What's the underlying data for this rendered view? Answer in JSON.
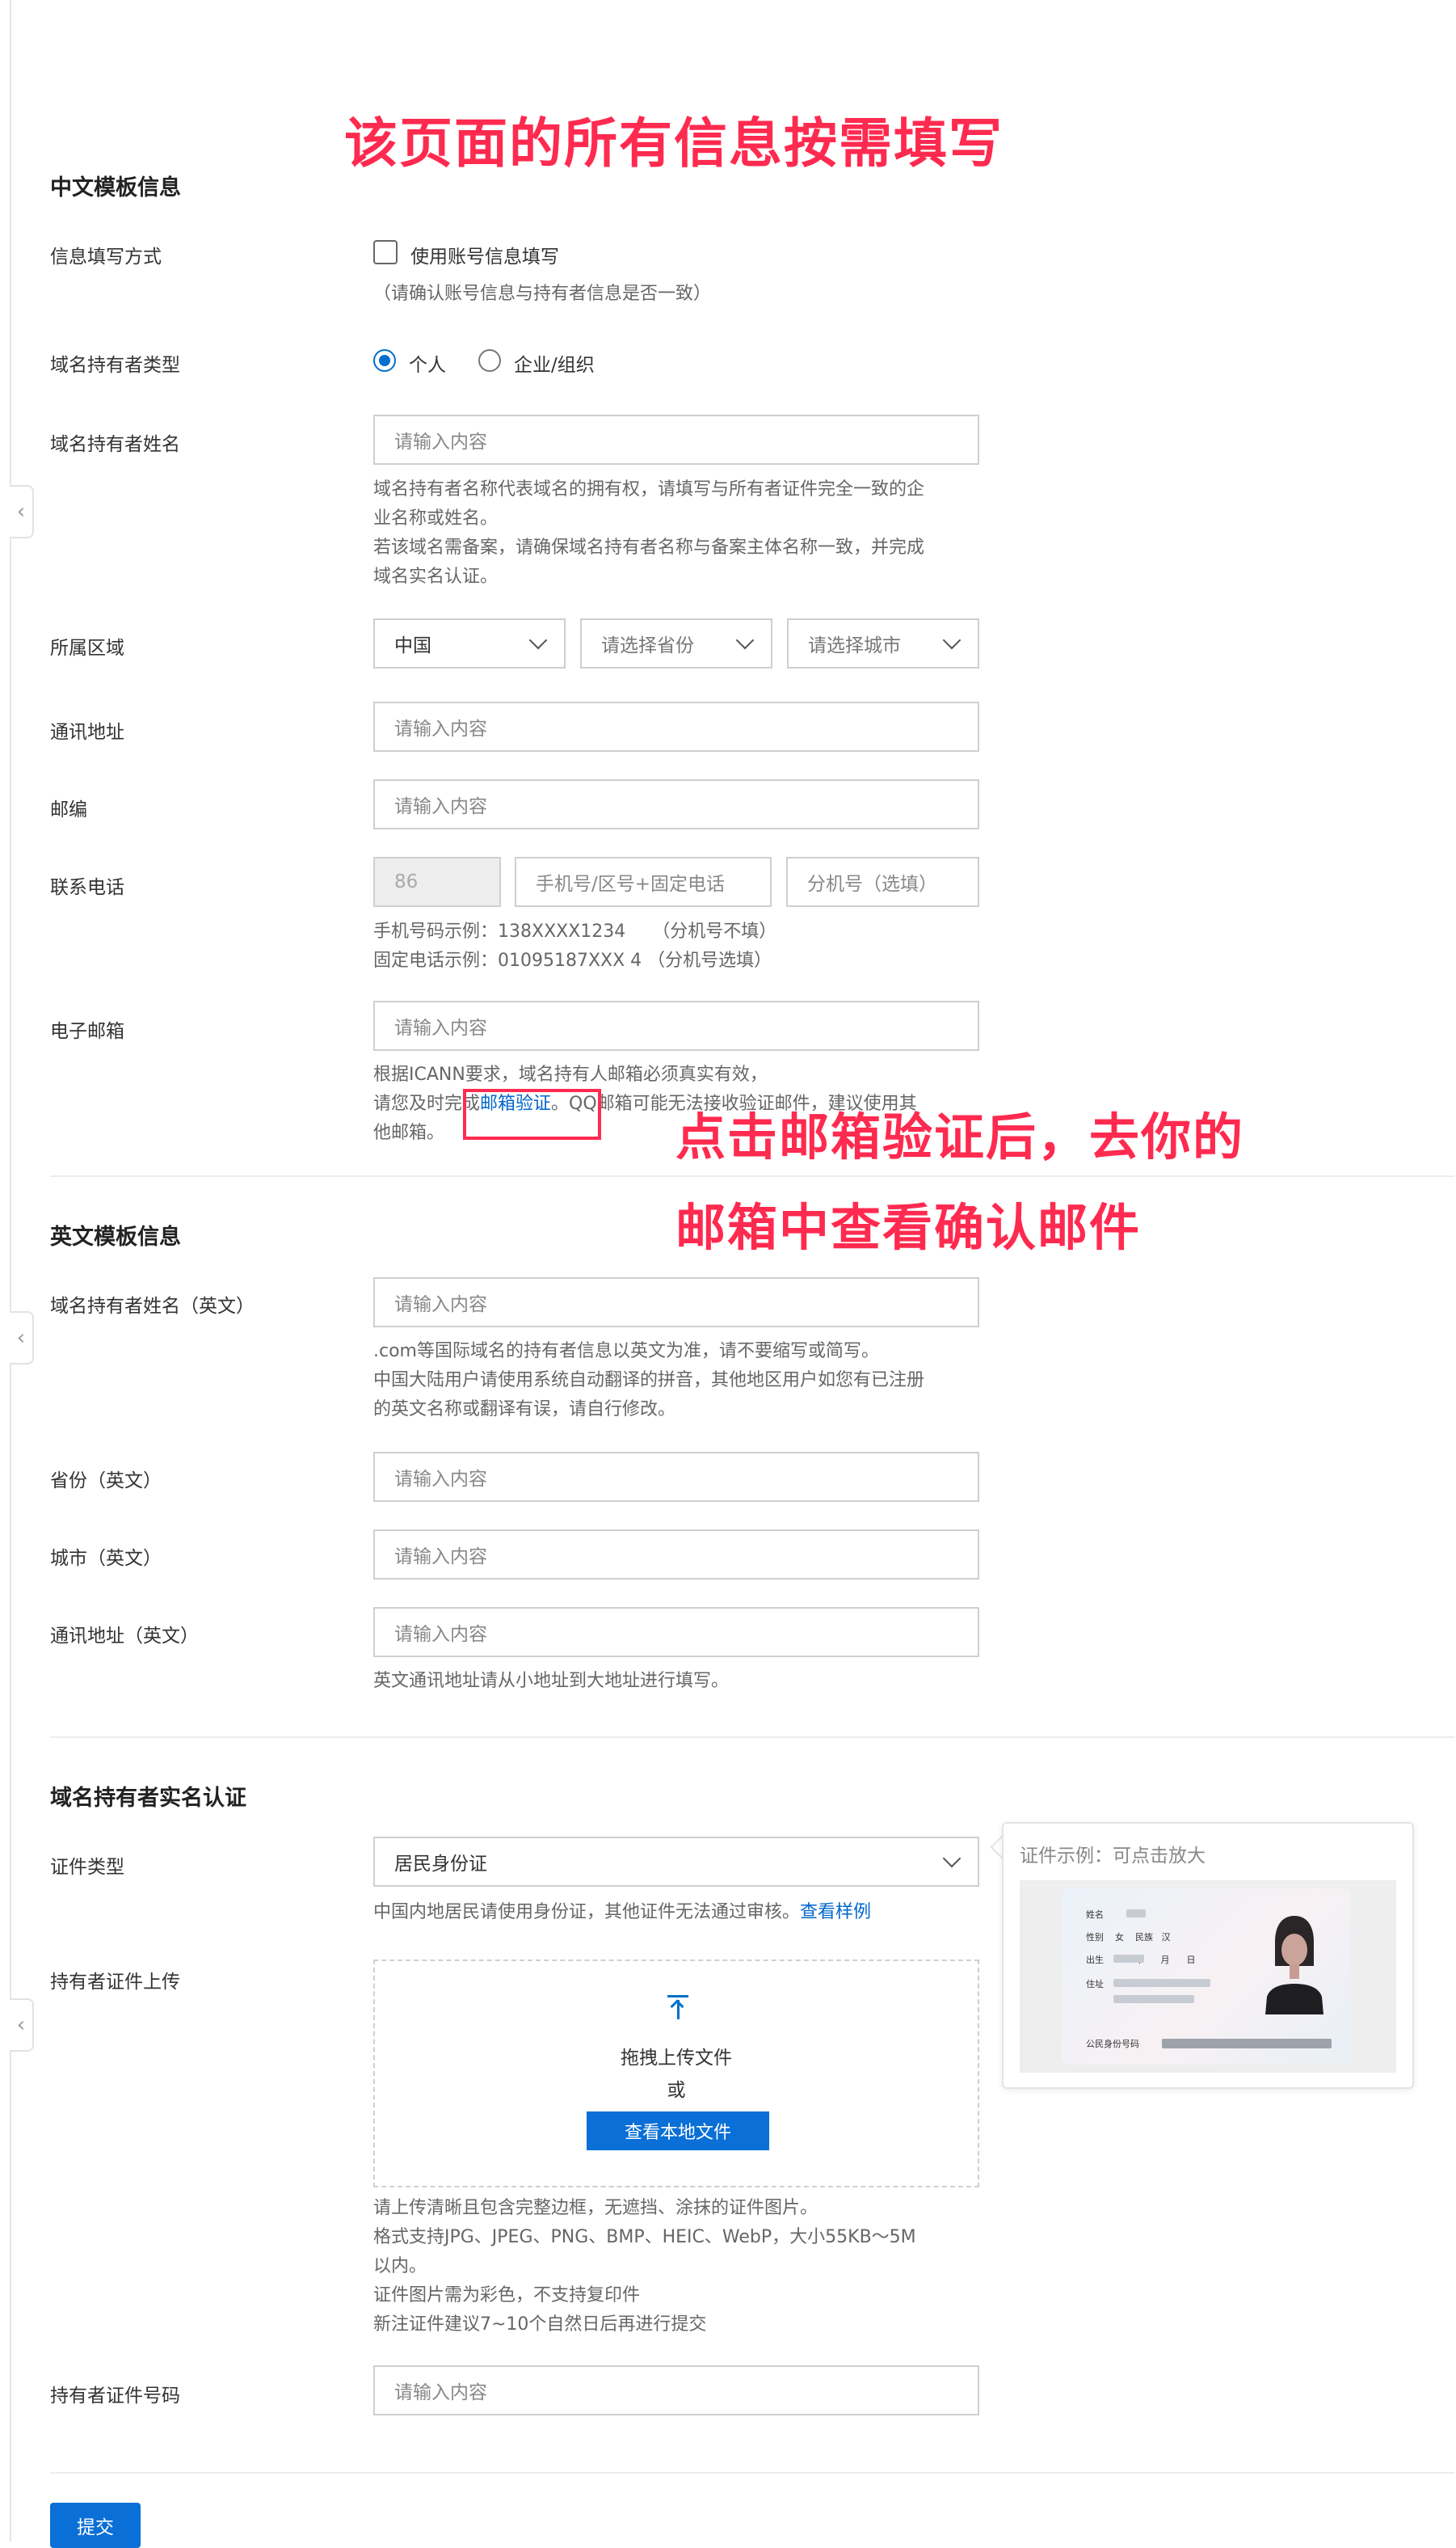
{
  "annotations": {
    "title": "该页面的所有信息按需填写",
    "note_line1": "点击邮箱验证后，去你的",
    "note_line2": "邮箱中查看确认邮件",
    "color": "#ff2a4f"
  },
  "chinese_section": {
    "title": "中文模板信息",
    "fill_method": {
      "label": "信息填写方式",
      "checkbox_label": "使用账号信息填写",
      "checked": false,
      "hint": "（请确认账号信息与持有者信息是否一致）"
    },
    "holder_type": {
      "label": "域名持有者类型",
      "options": [
        "个人",
        "企业/组织"
      ],
      "selected": "个人"
    },
    "holder_name": {
      "label": "域名持有者姓名",
      "placeholder": "请输入内容",
      "help": [
        "域名持有者名称代表域名的拥有权，请填写与所有者证件完全一致的企",
        "业名称或姓名。",
        "若该域名需备案，请确保域名持有者名称与备案主体名称一致，并完成",
        "域名实名认证。"
      ]
    },
    "region": {
      "label": "所属区域",
      "country": "中国",
      "province_placeholder": "请选择省份",
      "city_placeholder": "请选择城市"
    },
    "address": {
      "label": "通讯地址",
      "placeholder": "请输入内容"
    },
    "postcode": {
      "label": "邮编",
      "placeholder": "请输入内容"
    },
    "phone": {
      "label": "联系电话",
      "country_code": "86",
      "number_placeholder": "手机号/区号+固定电话",
      "ext_placeholder": "分机号（选填）",
      "help": [
        "手机号码示例：138XXXX1234　　（分机号不填）",
        "固定电话示例：01095187XXX 4 （分机号选填）"
      ]
    },
    "email": {
      "label": "电子邮箱",
      "placeholder": "请输入内容",
      "help_line1": "根据ICANN要求，域名持有人邮箱必须真实有效，",
      "help_line2_prefix": "请您及时完成",
      "help_link": "邮箱验证",
      "help_line2_suffix": "。QQ邮箱可能无法接收验证邮件，建议使用其",
      "help_line3": "他邮箱。"
    }
  },
  "english_section": {
    "title": "英文模板信息",
    "holder_name_en": {
      "label": "域名持有者姓名（英文）",
      "placeholder": "请输入内容",
      "help": [
        ".com等国际域名的持有者信息以英文为准，请不要缩写或简写。",
        "中国大陆用户请使用系统自动翻译的拼音，其他地区用户如您有已注册",
        "的英文名称或翻译有误，请自行修改。"
      ]
    },
    "province_en": {
      "label": "省份（英文）",
      "placeholder": "请输入内容"
    },
    "city_en": {
      "label": "城市（英文）",
      "placeholder": "请输入内容"
    },
    "address_en": {
      "label": "通讯地址（英文）",
      "placeholder": "请输入内容",
      "help": "英文通讯地址请从小地址到大地址进行填写。"
    }
  },
  "verification_section": {
    "title": "域名持有者实名认证",
    "id_type": {
      "label": "证件类型",
      "value": "居民身份证",
      "help_prefix": "中国内地居民请使用身份证，其他证件无法通过审核。",
      "help_link": "查看样例"
    },
    "upload": {
      "label": "持有者证件上传",
      "drag_text": "拖拽上传文件",
      "or_text": "或",
      "browse_label": "查看本地文件",
      "help": [
        "请上传清晰且包含完整边框，无遮挡、涂抹的证件图片。",
        "格式支持JPG、JPEG、PNG、BMP、HEIC、WebP，大小55KB～5M",
        "以内。",
        "证件图片需为彩色，不支持复印件",
        "新注证件建议7~10个自然日后再进行提交"
      ]
    },
    "sample": {
      "caption": "证件示例：可点击放大",
      "fields": [
        "姓名",
        "性别",
        "女",
        "民族",
        "汉",
        "出生",
        "年",
        "月",
        "日",
        "住址",
        "公民身份号码"
      ]
    },
    "id_number": {
      "label": "持有者证件号码",
      "placeholder": "请输入内容"
    }
  },
  "submit_label": "提交",
  "colors": {
    "primary": "#0a6fd6",
    "link": "#0066cc",
    "annotation": "#ff2a4f"
  }
}
